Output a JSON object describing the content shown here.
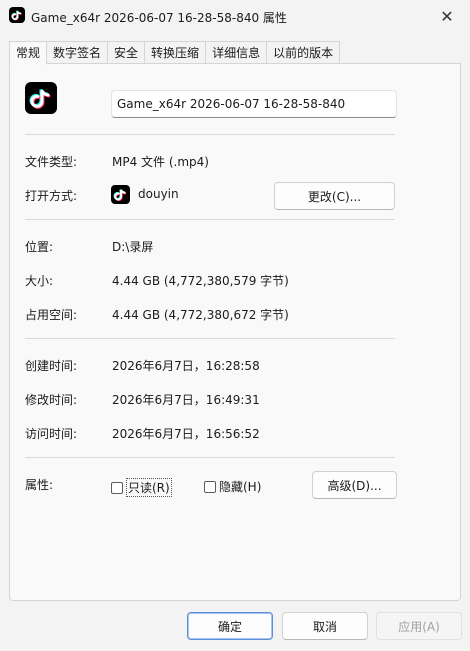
{
  "window": {
    "title": "Game_x64r 2026-06-07 16-28-58-840 属性",
    "close_glyph": "✕"
  },
  "tabs": [
    {
      "label": "常规",
      "active": true
    },
    {
      "label": "数字签名"
    },
    {
      "label": "安全"
    },
    {
      "label": "转换压缩"
    },
    {
      "label": "详细信息"
    },
    {
      "label": "以前的版本"
    }
  ],
  "general": {
    "file_icon": "tiktok-logo-icon",
    "file_name": "Game_x64r 2026-06-07 16-28-58-840",
    "type_label": "文件类型:",
    "type_value": "MP4 文件 (.mp4)",
    "open_with_label": "打开方式:",
    "open_with_app": "douyin",
    "change_button": "更改(C)...",
    "location_label": "位置:",
    "location_value": "D:\\录屏",
    "size_label": "大小:",
    "size_value": "4.44 GB (4,772,380,579 字节)",
    "disk_size_label": "占用空间:",
    "disk_size_value": "4.44 GB (4,772,380,672 字节)",
    "created_label": "创建时间:",
    "created_value": "2026年6月7日，16:28:58",
    "modified_label": "修改时间:",
    "modified_value": "2026年6月7日，16:49:31",
    "accessed_label": "访问时间:",
    "accessed_value": "2026年6月7日，16:56:52",
    "attributes_label": "属性:",
    "readonly_label": "只读(R)",
    "hidden_label": "隐藏(H)",
    "advanced_button": "高级(D)..."
  },
  "footer": {
    "ok": "确定",
    "cancel": "取消",
    "apply": "应用(A)"
  },
  "colors": {
    "accent_border": "#5b8fd9",
    "tiktok_cyan": "#25f4ee",
    "tiktok_red": "#fe2c55"
  }
}
